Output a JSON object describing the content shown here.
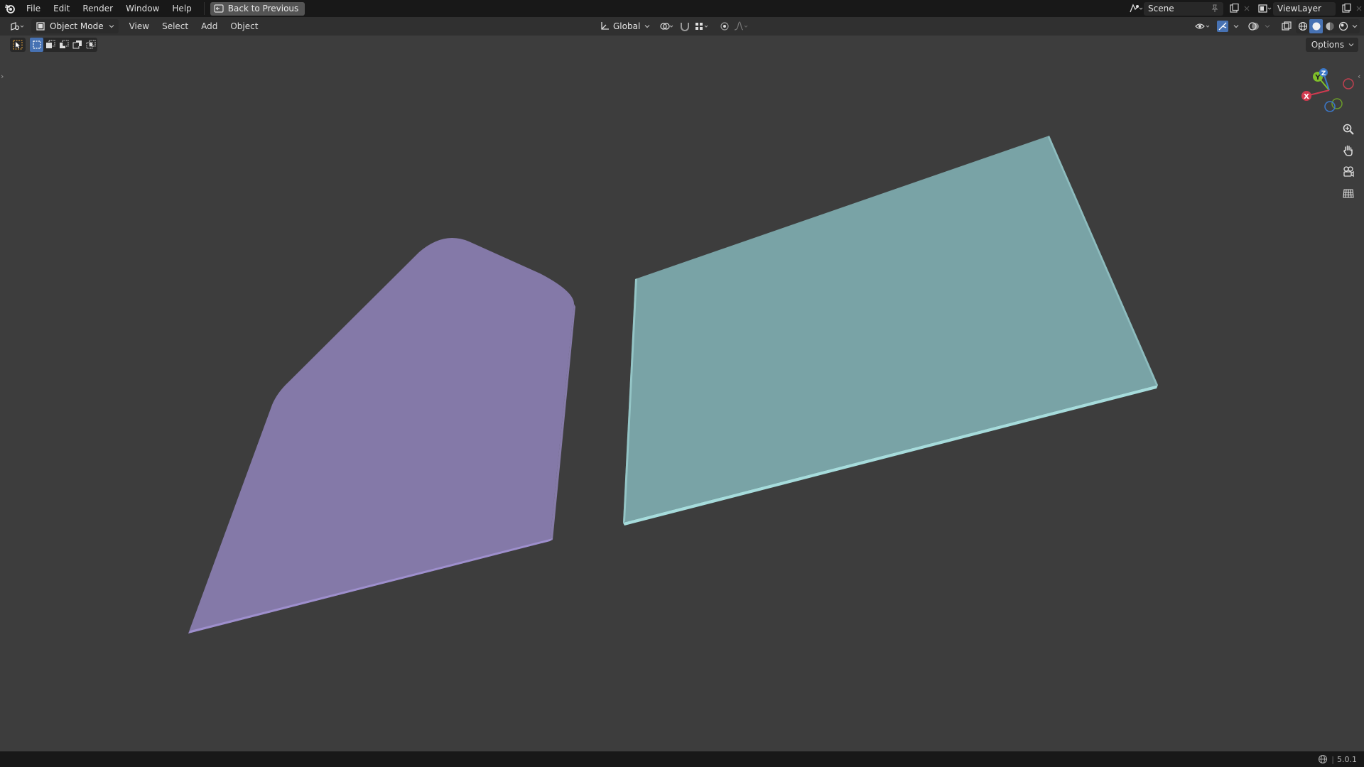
{
  "topbar": {
    "menu": [
      "File",
      "Edit",
      "Render",
      "Window",
      "Help"
    ],
    "back_button": "Back to Previous",
    "scene": "Scene",
    "view_layer": "ViewLayer"
  },
  "header": {
    "mode": "Object Mode",
    "menus": [
      "View",
      "Select",
      "Add",
      "Object"
    ],
    "orientation": "Global"
  },
  "options_label": "Options",
  "status": {
    "version": "5.0.1"
  },
  "objects": [
    {
      "name": "purple-plane",
      "color": "#8479a8",
      "edge_color": "#a595d6"
    },
    {
      "name": "teal-plane",
      "color": "#79a3a6",
      "edge_color": "#a6dcdc"
    }
  ],
  "colors": {
    "background": "#3d3d3d",
    "accent": "#4772b3",
    "axis_x": "#d13a4f",
    "axis_y": "#7fbf2a",
    "axis_z": "#3b78c9"
  },
  "icons": {
    "logo": "blender-logo-icon",
    "nav": [
      "zoom-icon",
      "hand-pan-icon",
      "camera-icon",
      "grid-ortho-icon"
    ]
  }
}
